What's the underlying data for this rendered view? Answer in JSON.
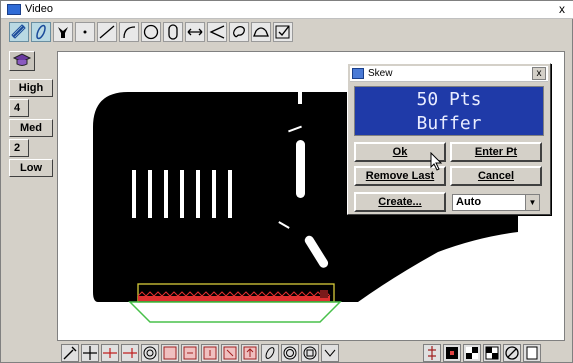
{
  "window": {
    "title": "Video",
    "close_glyph": "x"
  },
  "toolbar": {
    "buttons": [
      {
        "name": "line-measure-icon"
      },
      {
        "name": "pen-measure-icon"
      },
      {
        "name": "feature-point-icon"
      },
      {
        "name": "point-icon"
      },
      {
        "name": "line-icon"
      },
      {
        "name": "arc-icon"
      },
      {
        "name": "circle-icon"
      },
      {
        "name": "slot-icon"
      },
      {
        "name": "distance-icon"
      },
      {
        "name": "angle-icon"
      },
      {
        "name": "blob-icon"
      },
      {
        "name": "arch-icon"
      },
      {
        "name": "check-tool-icon"
      }
    ]
  },
  "left_panel": {
    "top_icon": "graduation-cap-icon",
    "items": [
      {
        "label": "High"
      },
      {
        "label": "4"
      },
      {
        "label": "Med"
      },
      {
        "label": "2"
      },
      {
        "label": "Low"
      }
    ]
  },
  "dialog": {
    "title": "Skew",
    "close_glyph": "x",
    "display_line1": "50 Pts",
    "display_line2": "Buffer",
    "ok_label": "Ok",
    "enter_pt_label": "Enter Pt",
    "remove_last_label": "Remove Last",
    "cancel_label": "Cancel",
    "create_label": "Create...",
    "mode_value": "Auto"
  },
  "bottom_toolbar": {
    "buttons": [
      {
        "name": "probe-icon"
      },
      {
        "name": "crosshair-icon"
      },
      {
        "name": "edge-tool-icon"
      },
      {
        "name": "edge-tool-2-icon"
      },
      {
        "name": "gear-target-icon"
      },
      {
        "name": "box-tool-icon"
      },
      {
        "name": "box-tool-2-icon"
      },
      {
        "name": "box-tool-3-icon"
      },
      {
        "name": "box-tool-4-icon"
      },
      {
        "name": "box-tool-5-icon"
      },
      {
        "name": "oval-tool-icon"
      },
      {
        "name": "ring-tool-icon"
      },
      {
        "name": "square-ring-icon"
      },
      {
        "name": "chevron-icon"
      },
      {
        "name": "light-axis-icon"
      },
      {
        "name": "light-1-icon"
      },
      {
        "name": "light-2-icon"
      },
      {
        "name": "light-3-icon"
      },
      {
        "name": "no-entry-icon"
      },
      {
        "name": "page-icon"
      }
    ]
  },
  "colors": {
    "display_bg": "#1f3aa8",
    "part_fill": "#000000",
    "selection_green": "#48c04a",
    "selection_red": "#e03030",
    "selection_yellow": "#d8cc3a"
  }
}
